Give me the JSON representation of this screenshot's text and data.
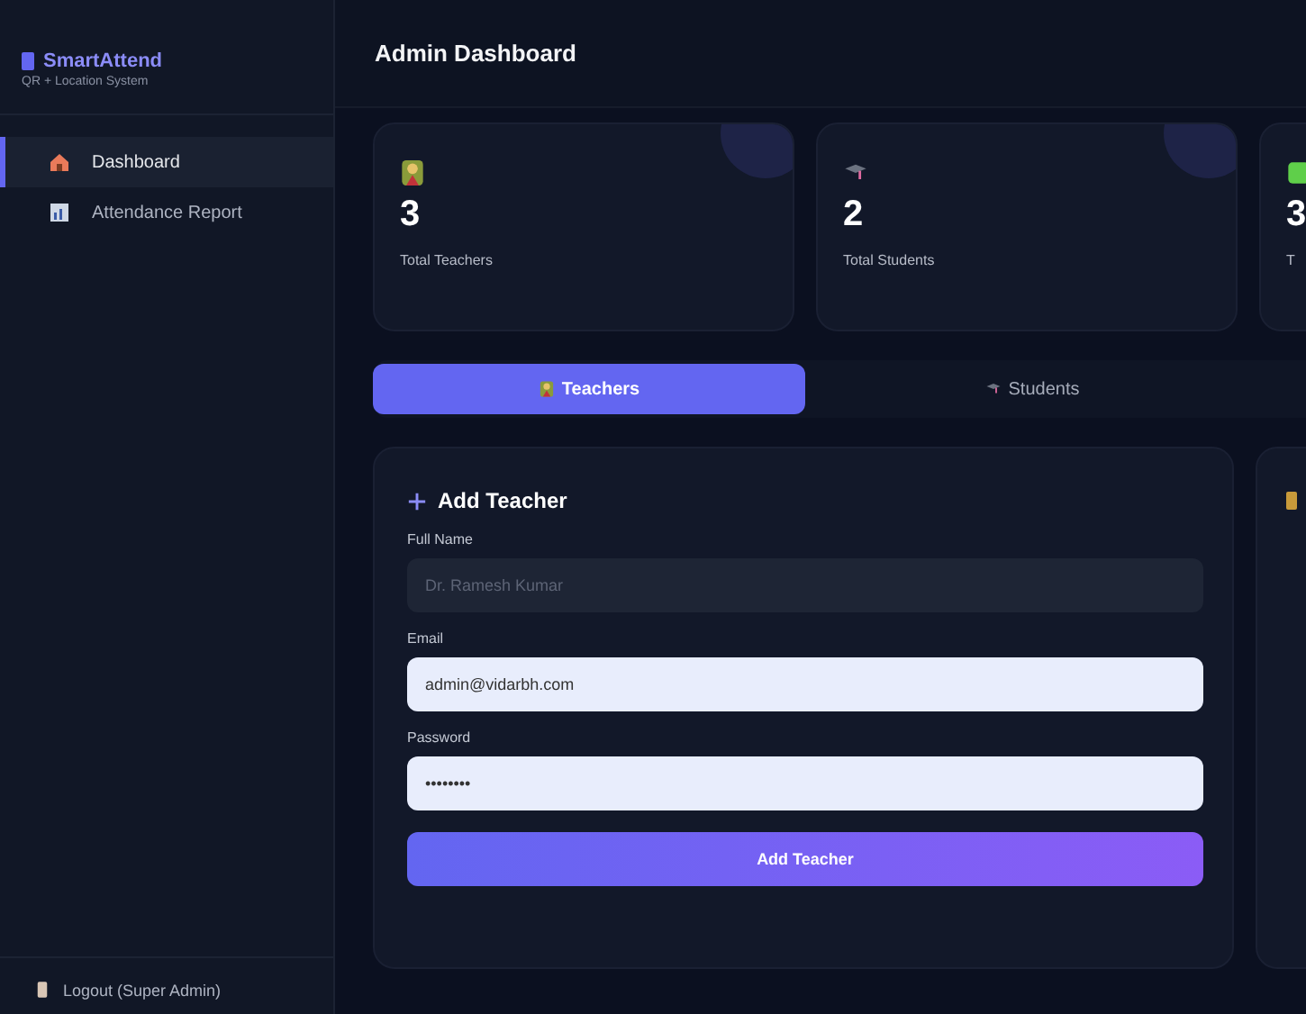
{
  "sidebar": {
    "brand": "SmartAttend",
    "subtitle": "QR + Location System",
    "items": [
      {
        "label": "Dashboard",
        "selected": true
      },
      {
        "label": "Attendance Report",
        "selected": false
      }
    ],
    "logout": "Logout (Super Admin)"
  },
  "header": {
    "title": "Admin Dashboard"
  },
  "stats": [
    {
      "value": "3",
      "label": "Total Teachers"
    },
    {
      "value": "2",
      "label": "Total Students"
    },
    {
      "value": "3",
      "label": "T"
    }
  ],
  "tabs": [
    {
      "label": "Teachers",
      "selected": true
    },
    {
      "label": "Students",
      "selected": false
    }
  ],
  "form": {
    "title": "Add Teacher",
    "fields": [
      {
        "label": "Full Name",
        "placeholder": "Dr. Ramesh Kumar",
        "filled": false
      },
      {
        "label": "Email",
        "value": "admin@vidarbh.com",
        "filled": true
      },
      {
        "label": "Password",
        "value": "••••••••",
        "filled": true
      }
    ],
    "submit": "Add Teacher"
  }
}
